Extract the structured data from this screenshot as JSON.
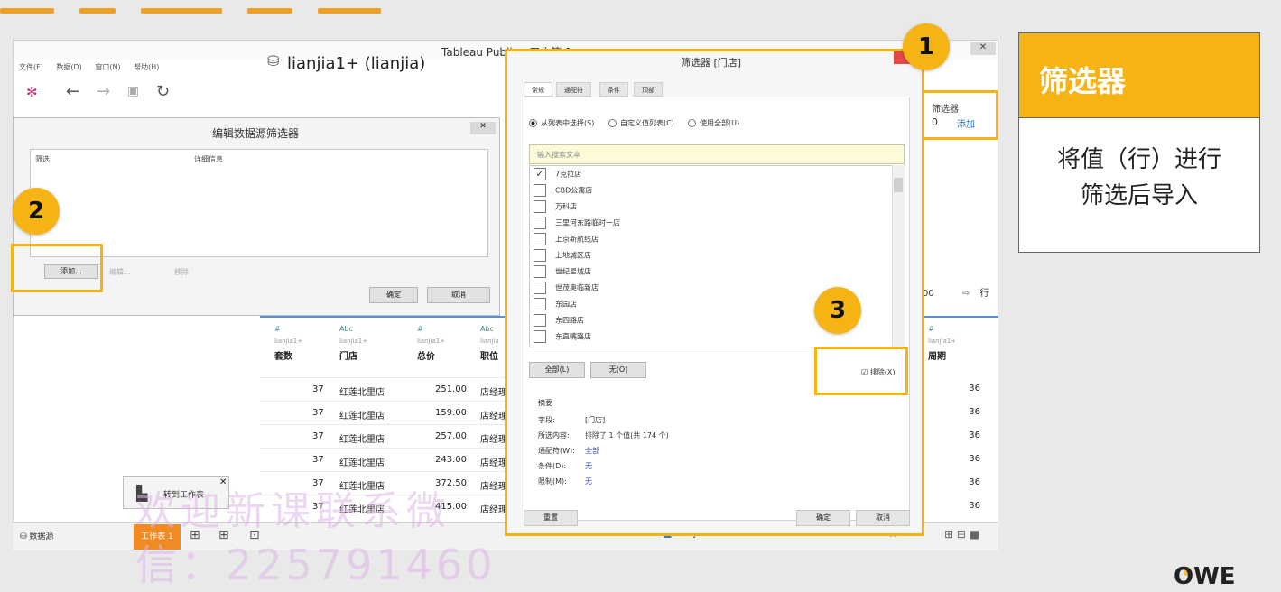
{
  "window": {
    "title": "Tableau Public - 工作簿 1"
  },
  "menu": [
    "文件(F)",
    "数据(D)",
    "窗口(N)",
    "帮助(H)"
  ],
  "datasource": {
    "name": "lianjia1+ (lianjia)"
  },
  "filters_panel": {
    "label": "筛选器",
    "count": "0",
    "add": "添加"
  },
  "edit_dialog": {
    "title": "编辑数据源筛选器",
    "col_filter": "筛选",
    "col_details": "详细信息",
    "add_btn": "添加...",
    "edit_btn": "编辑...",
    "remove_btn": "移除",
    "ok": "确定",
    "cancel": "取消"
  },
  "grid": {
    "columns": [
      {
        "type": "#",
        "src": "lianjia1+",
        "name": "套数"
      },
      {
        "type": "Abc",
        "src": "lianjia1+",
        "name": "门店"
      },
      {
        "type": "#",
        "src": "lianjia1+",
        "name": "总价"
      },
      {
        "type": "Abc",
        "src": "lianjia",
        "name": "职位"
      }
    ],
    "right_column": {
      "type": "#",
      "src": "lianjia1+",
      "name": "周期"
    },
    "rows": [
      {
        "c1": "37",
        "c2": "红莲北里店",
        "c3": "251.00",
        "c4": "店经理",
        "r": "36"
      },
      {
        "c1": "37",
        "c2": "红莲北里店",
        "c3": "159.00",
        "c4": "店经理",
        "r": "36"
      },
      {
        "c1": "37",
        "c2": "红莲北里店",
        "c3": "257.00",
        "c4": "店经理",
        "r": "36"
      },
      {
        "c1": "37",
        "c2": "红莲北里店",
        "c3": "243.00",
        "c4": "店经理",
        "r": "36"
      },
      {
        "c1": "37",
        "c2": "红莲北里店",
        "c3": "372.50",
        "c4": "店经理",
        "r": "36"
      },
      {
        "c1": "37",
        "c2": "红莲北里店",
        "c3": "415.00",
        "c4": "店经理",
        "r": "36"
      }
    ],
    "right_input": "00",
    "right_rows_label": "行"
  },
  "bottom": {
    "datasource_tab": "数据源",
    "sheet_tab": "工作表 1",
    "user": "Manyu",
    "goto": "转到工作表"
  },
  "filter_dialog": {
    "title": "筛选器 [门店]",
    "tabs": [
      "常规",
      "通配符",
      "条件",
      "顶部"
    ],
    "radios": [
      "从列表中选择(S)",
      "自定义值列表(C)",
      "使用全部(U)"
    ],
    "search_placeholder": "输入搜索文本",
    "items": [
      {
        "label": "7克拉店",
        "checked": true
      },
      {
        "label": "CBD公寓店",
        "checked": false
      },
      {
        "label": "万科店",
        "checked": false
      },
      {
        "label": "三里河东路临时一店",
        "checked": false
      },
      {
        "label": "上京新航线店",
        "checked": false
      },
      {
        "label": "上地城区店",
        "checked": false
      },
      {
        "label": "世纪星城店",
        "checked": false
      },
      {
        "label": "世茂奥临新店",
        "checked": false
      },
      {
        "label": "东园店",
        "checked": false
      },
      {
        "label": "东四路店",
        "checked": false
      },
      {
        "label": "东直嘴路店",
        "checked": false
      }
    ],
    "all_btn": "全部(L)",
    "none_btn": "无(O)",
    "exclude": "排除(X)",
    "summary": {
      "title": "摘要",
      "rows": [
        {
          "k": "字段:",
          "v": "[门店]",
          "blue": false
        },
        {
          "k": "所选内容:",
          "v": "排除了 1 个值(共 174 个)",
          "blue": false
        },
        {
          "k": "通配符(W):",
          "v": "全部",
          "blue": true
        },
        {
          "k": "条件(D):",
          "v": "无",
          "blue": true
        },
        {
          "k": "限制(M):",
          "v": "无",
          "blue": true
        }
      ]
    },
    "reset": "重置",
    "ok": "确定",
    "cancel": "取消"
  },
  "badges": [
    "1",
    "2",
    "3"
  ],
  "card": {
    "title": "筛选器",
    "body_line1": "将值（行）进行",
    "body_line2": "筛选后导入"
  },
  "watermark": {
    "line1": "欢迎新课联系微",
    "line2": "信：225791460"
  },
  "logo": "OWE",
  "colors": {
    "accent": "#f5b414",
    "sheet_tab": "#f08a24",
    "link": "#2b6cb0"
  }
}
